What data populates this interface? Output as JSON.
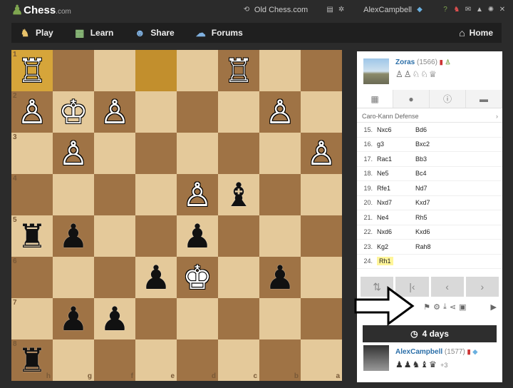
{
  "header": {
    "logo": "Chess",
    "logo_suffix": ".com",
    "old_chess": "Old Chess.com",
    "username": "AlexCampbell"
  },
  "nav": {
    "items": [
      {
        "label": "Play",
        "icon": "play-icon"
      },
      {
        "label": "Learn",
        "icon": "learn-icon"
      },
      {
        "label": "Share",
        "icon": "share-icon"
      },
      {
        "label": "Forums",
        "icon": "forums-icon"
      }
    ],
    "home": "Home"
  },
  "board": {
    "rank_labels": [
      "1",
      "2",
      "3",
      "4",
      "5",
      "6",
      "7",
      "8"
    ],
    "file_labels": [
      "h",
      "g",
      "f",
      "e",
      "d",
      "c",
      "b",
      "a"
    ],
    "rows": [
      [
        "♖",
        "",
        "",
        "",
        "",
        "♖",
        "",
        ""
      ],
      [
        "♙",
        "♔",
        "♙",
        "",
        "",
        "",
        "♙",
        ""
      ],
      [
        "",
        "♙",
        "",
        "",
        "",
        "",
        "",
        "♙"
      ],
      [
        "",
        "",
        "",
        "",
        "♙",
        "♝",
        "",
        ""
      ],
      [
        "♜",
        "♟",
        "",
        "",
        "♟",
        "",
        "",
        ""
      ],
      [
        "",
        "",
        "",
        "♟",
        "♚",
        "",
        "♟",
        ""
      ],
      [
        "",
        "♟",
        "♟",
        "",
        "",
        "",
        "",
        ""
      ],
      [
        "♜",
        "",
        "",
        "",
        "",
        "",
        "",
        ""
      ]
    ],
    "colors": [
      [
        "w",
        "",
        "",
        "",
        "",
        "w",
        "",
        ""
      ],
      [
        "w",
        "w",
        "w",
        "",
        "",
        "",
        "w",
        ""
      ],
      [
        "",
        "w",
        "",
        "",
        "",
        "",
        "",
        "w"
      ],
      [
        "",
        "",
        "",
        "",
        "w",
        "b",
        "",
        ""
      ],
      [
        "b",
        "b",
        "",
        "",
        "b",
        "",
        "",
        ""
      ],
      [
        "",
        "",
        "",
        "b",
        "w",
        "",
        "b",
        ""
      ],
      [
        "",
        "b",
        "b",
        "",
        "",
        "",
        "",
        ""
      ],
      [
        "b",
        "",
        "",
        "",
        "",
        "",
        "",
        ""
      ]
    ]
  },
  "opponent": {
    "name": "Zoras",
    "rating": "(1566)",
    "captured": "♙♙♘♘♕"
  },
  "panel": {
    "opening": "Caro-Kann Defense",
    "moves": [
      {
        "n": "15.",
        "w": "Nxc6",
        "b": "Bd6"
      },
      {
        "n": "16.",
        "w": "g3",
        "b": "Bxc2"
      },
      {
        "n": "17.",
        "w": "Rac1",
        "b": "Bb3"
      },
      {
        "n": "18.",
        "w": "Ne5",
        "b": "Bc4"
      },
      {
        "n": "19.",
        "w": "Rfe1",
        "b": "Nd7"
      },
      {
        "n": "20.",
        "w": "Nxd7",
        "b": "Kxd7"
      },
      {
        "n": "21.",
        "w": "Ne4",
        "b": "Rh5"
      },
      {
        "n": "22.",
        "w": "Nxd6",
        "b": "Kxd6"
      },
      {
        "n": "23.",
        "w": "Kg2",
        "b": "Rah8"
      },
      {
        "n": "24.",
        "w": "Rh1",
        "b": ""
      }
    ],
    "timer": "4 days"
  },
  "player": {
    "name": "AlexCampbell",
    "rating": "(1577)",
    "captured": "♟♟♞♝♛",
    "extra": "+3"
  }
}
